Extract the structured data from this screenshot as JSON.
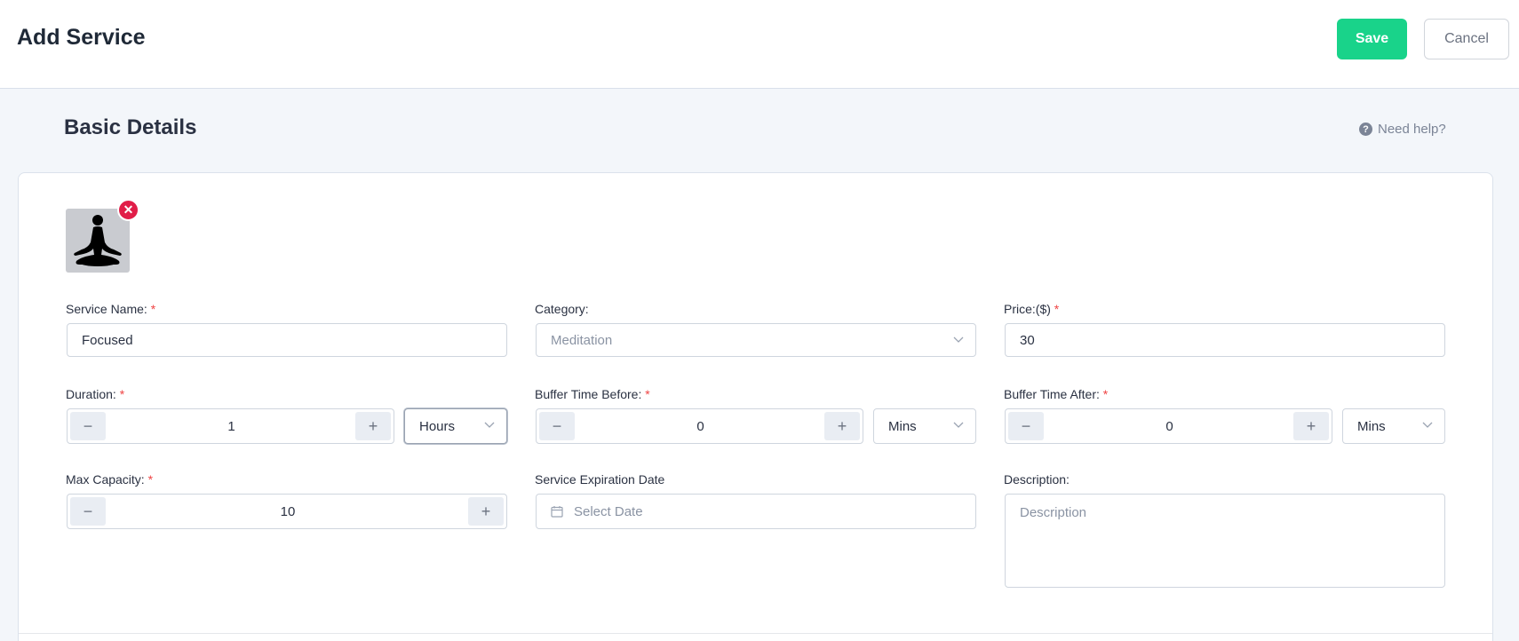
{
  "header": {
    "title": "Add Service",
    "save_label": "Save",
    "cancel_label": "Cancel"
  },
  "section": {
    "title": "Basic Details",
    "help_label": "Need help?"
  },
  "image": {
    "alt": "meditation"
  },
  "fields": {
    "service_name": {
      "label": "Service Name:",
      "required": "*",
      "value": "Focused"
    },
    "category": {
      "label": "Category:",
      "value": "Meditation"
    },
    "price": {
      "label": "Price:($)",
      "required": "*",
      "value": "30"
    },
    "duration": {
      "label": "Duration:",
      "required": "*",
      "value": "1",
      "unit": "Hours"
    },
    "buffer_before": {
      "label": "Buffer Time Before:",
      "required": "*",
      "value": "0",
      "unit": "Mins"
    },
    "buffer_after": {
      "label": "Buffer Time After:",
      "required": "*",
      "value": "0",
      "unit": "Mins"
    },
    "max_capacity": {
      "label": "Max Capacity:",
      "required": "*",
      "value": "10"
    },
    "expiration": {
      "label": "Service Expiration Date",
      "placeholder": "Select Date"
    },
    "description": {
      "label": "Description:",
      "placeholder": "Description"
    }
  },
  "icons": {
    "minus": "−",
    "plus": "+",
    "remove": "✕",
    "help": "?"
  },
  "colors": {
    "save": "#19d38a",
    "required": "#ef4444",
    "remove": "#e11d48"
  }
}
